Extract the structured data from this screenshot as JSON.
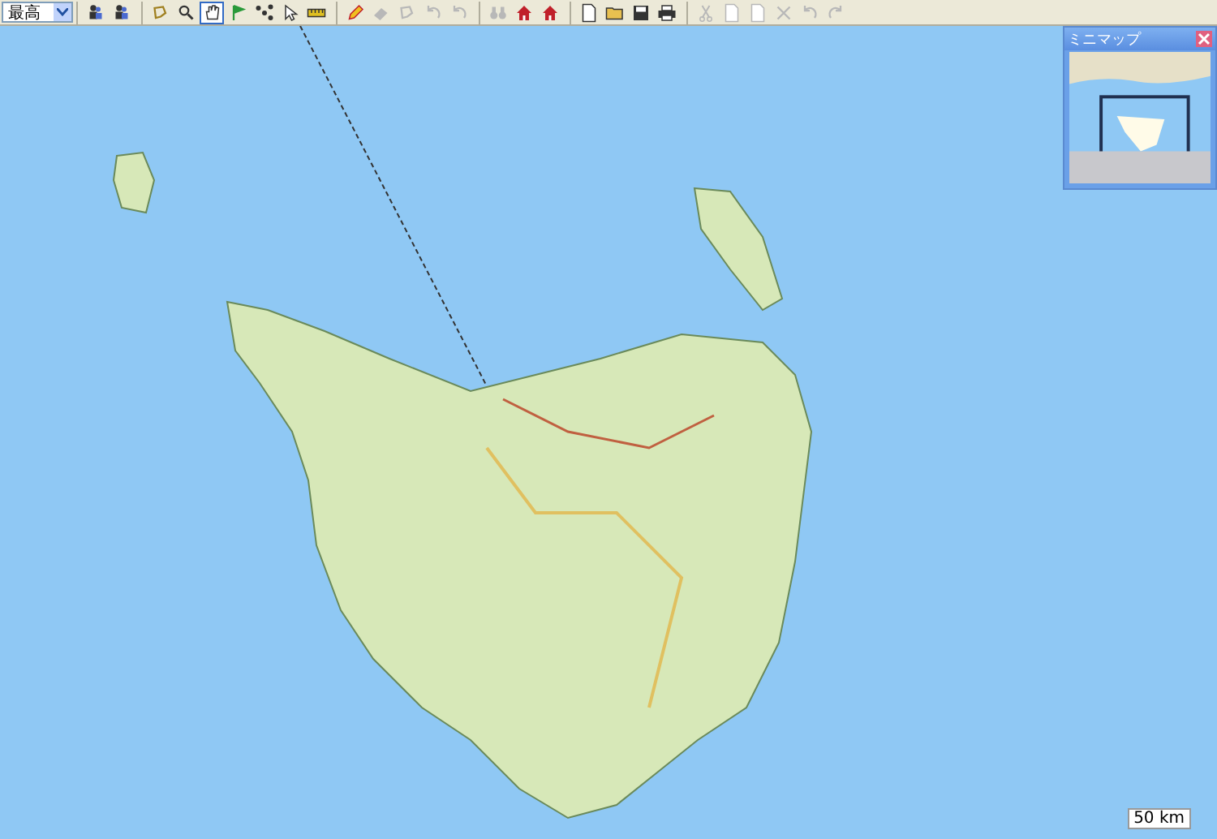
{
  "toolbar": {
    "quality_dropdown": {
      "value": "最高"
    },
    "groups": [
      [
        {
          "kind": "person",
          "disabled": false,
          "selected": false
        },
        {
          "kind": "person",
          "disabled": false,
          "selected": false
        }
      ],
      [
        {
          "kind": "lasso",
          "disabled": false,
          "selected": false
        },
        {
          "kind": "zoom",
          "disabled": false,
          "selected": false
        },
        {
          "kind": "hand",
          "disabled": false,
          "selected": true
        },
        {
          "kind": "flag",
          "disabled": false,
          "selected": false
        },
        {
          "kind": "route",
          "disabled": false,
          "selected": false
        },
        {
          "kind": "pointer",
          "disabled": false,
          "selected": false
        },
        {
          "kind": "ruler",
          "disabled": false,
          "selected": false
        }
      ],
      [
        {
          "kind": "pencil",
          "disabled": false,
          "selected": false
        },
        {
          "kind": "eraser",
          "disabled": true,
          "selected": false
        },
        {
          "kind": "lasso",
          "disabled": true,
          "selected": false
        },
        {
          "kind": "undo",
          "disabled": true,
          "selected": false
        },
        {
          "kind": "undo",
          "disabled": true,
          "selected": false
        }
      ],
      [
        {
          "kind": "binoculars",
          "disabled": true,
          "selected": false
        },
        {
          "kind": "house",
          "disabled": false,
          "selected": false
        },
        {
          "kind": "house",
          "disabled": false,
          "selected": false
        }
      ],
      [
        {
          "kind": "document",
          "disabled": false,
          "selected": false
        },
        {
          "kind": "folder",
          "disabled": false,
          "selected": false
        },
        {
          "kind": "disk",
          "disabled": false,
          "selected": false
        },
        {
          "kind": "printer",
          "disabled": false,
          "selected": false
        }
      ],
      [
        {
          "kind": "scissors",
          "disabled": true,
          "selected": false
        },
        {
          "kind": "document",
          "disabled": true,
          "selected": false
        },
        {
          "kind": "document",
          "disabled": true,
          "selected": false
        },
        {
          "kind": "delete",
          "disabled": true,
          "selected": false
        },
        {
          "kind": "undo",
          "disabled": true,
          "selected": false
        },
        {
          "kind": "redo",
          "disabled": true,
          "selected": false
        }
      ]
    ]
  },
  "minimap": {
    "title": "ミニマップ"
  },
  "scale": {
    "label": "50 km"
  }
}
